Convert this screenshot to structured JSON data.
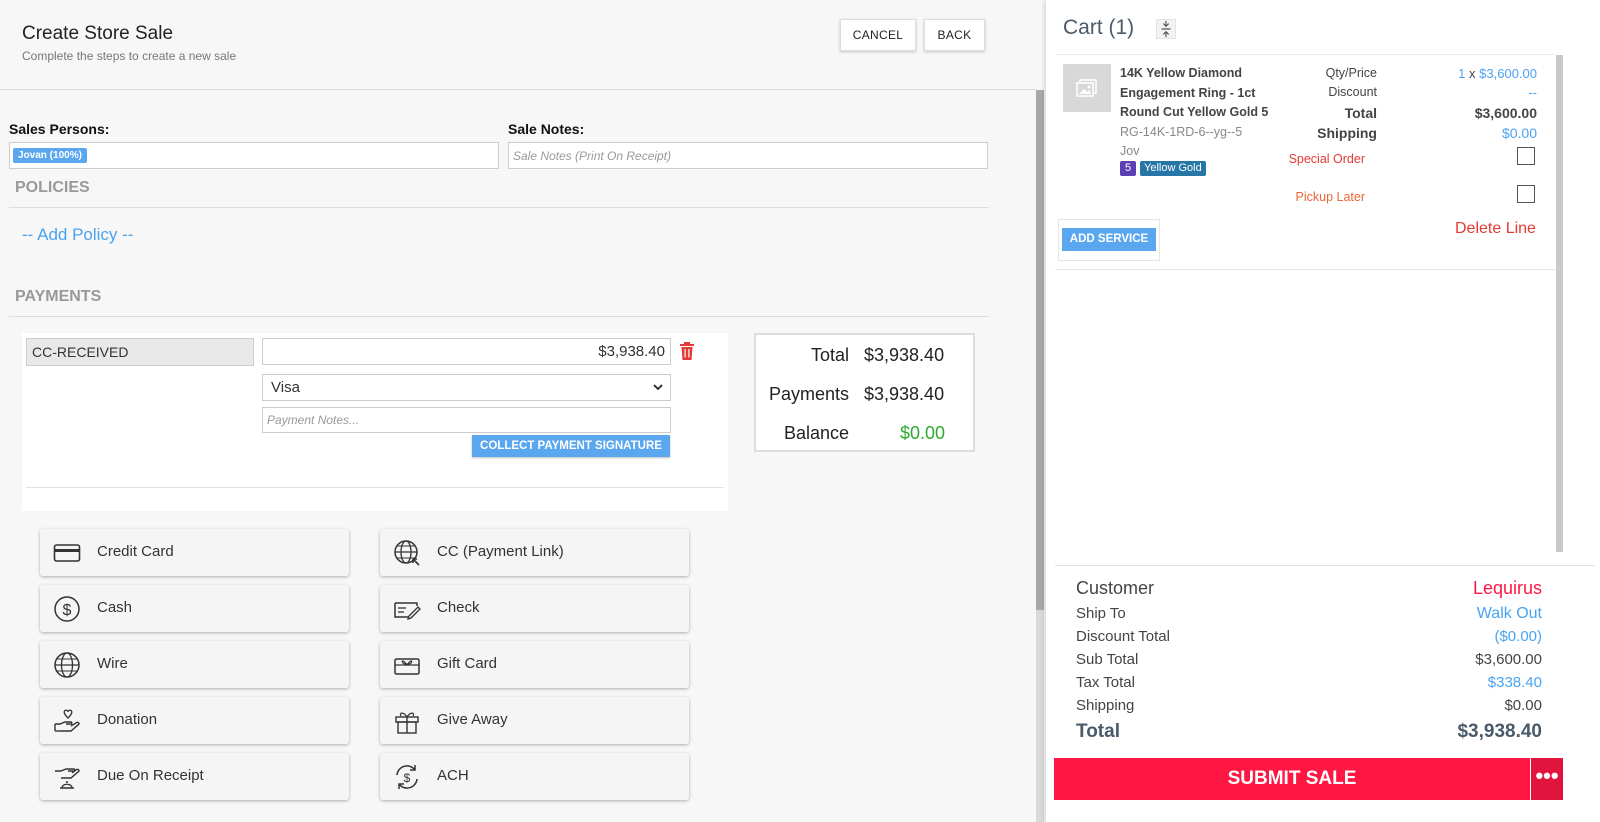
{
  "header": {
    "title": "Create Store Sale",
    "subtitle": "Complete the steps to create a new sale",
    "cancel_label": "CANCEL",
    "back_label": "BACK"
  },
  "sales_persons": {
    "label": "Sales Persons:",
    "chip": "Jovan (100%)"
  },
  "sale_notes": {
    "label": "Sale Notes:",
    "placeholder": "Sale Notes (Print On Receipt)"
  },
  "policies": {
    "title": "POLICIES",
    "add_label": "-- Add Policy --"
  },
  "payments": {
    "title": "PAYMENTS",
    "entry": {
      "type": "CC-RECEIVED",
      "amount": "$3,938.40",
      "card_type": "Visa",
      "notes_placeholder": "Payment Notes...",
      "collect_label": "COLLECT PAYMENT SIGNATURE"
    },
    "summary": {
      "total_label": "Total",
      "total_value": "$3,938.40",
      "payments_label": "Payments",
      "payments_value": "$3,938.40",
      "balance_label": "Balance",
      "balance_value": "$0.00"
    },
    "methods": [
      {
        "label": "Credit Card",
        "icon": "credit-card-icon"
      },
      {
        "label": "CC (Payment Link)",
        "icon": "globe-link-icon"
      },
      {
        "label": "Cash",
        "icon": "dollar-circle-icon"
      },
      {
        "label": "Check",
        "icon": "check-icon"
      },
      {
        "label": "Wire",
        "icon": "globe-icon"
      },
      {
        "label": "Gift Card",
        "icon": "gift-card-icon"
      },
      {
        "label": "Donation",
        "icon": "donation-icon"
      },
      {
        "label": "Give Away",
        "icon": "gift-icon"
      },
      {
        "label": "Due On Receipt",
        "icon": "due-on-receipt-icon"
      },
      {
        "label": "ACH",
        "icon": "ach-icon"
      }
    ]
  },
  "cart": {
    "title": "Cart (1)",
    "item": {
      "name_lines": [
        "14K Yellow Diamond",
        "Engagement Ring - 1ct",
        "Round Cut Yellow Gold 5"
      ],
      "sku": "RG-14K-1RD-6--yg--5",
      "salesperson": "Jov",
      "badge_size": "5",
      "badge_metal": "Yellow Gold",
      "qty_price_label": "Qty/Price",
      "qty": "1",
      "qty_sep": "x",
      "price": "$3,600.00",
      "discount_label": "Discount",
      "discount_value": "--",
      "total_label": "Total",
      "total_value": "$3,600.00",
      "shipping_label": "Shipping",
      "shipping_value": "$0.00",
      "special_order_label": "Special Order",
      "pickup_later_label": "Pickup Later",
      "add_service_label": "ADD SERVICE",
      "delete_line_label": "Delete Line"
    },
    "summary": {
      "customer_label": "Customer",
      "customer_value": "Lequirus",
      "ship_to_label": "Ship To",
      "ship_to_value": "Walk Out",
      "discount_total_label": "Discount Total",
      "discount_total_value": "($0.00)",
      "sub_total_label": "Sub Total",
      "sub_total_value": "$3,600.00",
      "tax_total_label": "Tax Total",
      "tax_total_value": "$338.40",
      "shipping_label": "Shipping",
      "shipping_value": "$0.00",
      "total_label": "Total",
      "total_value": "$3,938.40"
    },
    "submit_label": "SUBMIT SALE",
    "more_label": "•••"
  },
  "colors": {
    "accent_blue": "#5aa7ef",
    "link_blue": "#4aa3f0",
    "danger_red": "#e53935",
    "submit_red": "#ff1744",
    "balance_green": "#2eaa2e"
  }
}
